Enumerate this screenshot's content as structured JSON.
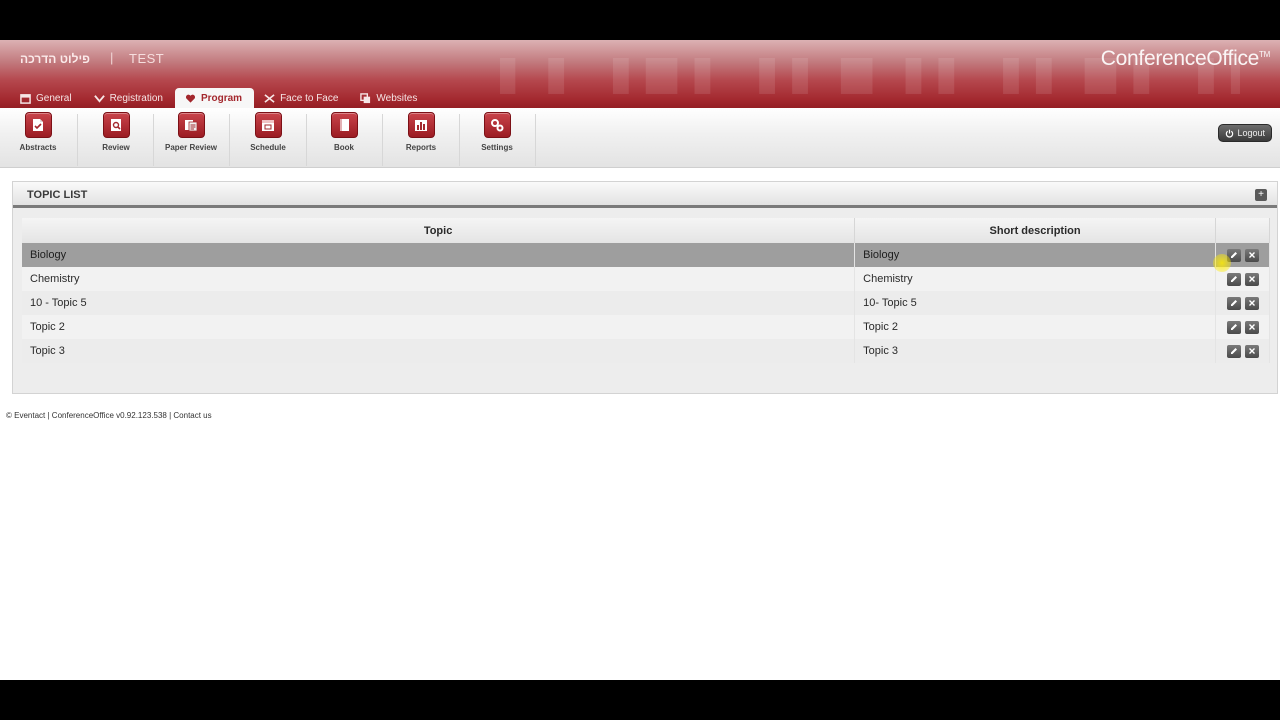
{
  "header": {
    "event_name": "פילוט הדרכה",
    "separator": "|",
    "event_code": "TEST",
    "brand": "ConferenceOffice",
    "brand_tm": "TM"
  },
  "tabs": [
    {
      "label": "General",
      "icon": "calendar-icon",
      "active": false
    },
    {
      "label": "Registration",
      "icon": "check-icon",
      "active": false
    },
    {
      "label": "Program",
      "icon": "heart-icon",
      "active": true
    },
    {
      "label": "Face to Face",
      "icon": "cross-arrows-icon",
      "active": false
    },
    {
      "label": "Websites",
      "icon": "globe-icon",
      "active": false
    }
  ],
  "toolbar": {
    "items": [
      {
        "label": "Abstracts",
        "icon": "abstracts-icon"
      },
      {
        "label": "Review",
        "icon": "review-icon"
      },
      {
        "label": "Paper Review",
        "icon": "paper-review-icon"
      },
      {
        "label": "Schedule",
        "icon": "schedule-icon"
      },
      {
        "label": "Book",
        "icon": "book-icon"
      },
      {
        "label": "Reports",
        "icon": "reports-icon"
      },
      {
        "label": "Settings",
        "icon": "settings-icon"
      }
    ],
    "logout_label": "Logout"
  },
  "panel": {
    "title": "TOPIC LIST",
    "toggle_symbol": "+"
  },
  "table": {
    "headers": [
      "Topic",
      "Short description"
    ],
    "rows": [
      {
        "topic": "Biology",
        "description": "Biology",
        "selected": true
      },
      {
        "topic": "Chemistry",
        "description": "Chemistry",
        "selected": false
      },
      {
        "topic": "10 - Topic 5",
        "description": "10- Topic 5",
        "selected": false
      },
      {
        "topic": "Topic 2",
        "description": "Topic 2",
        "selected": false
      },
      {
        "topic": "Topic 3",
        "description": "Topic 3",
        "selected": false
      }
    ]
  },
  "footer": {
    "copyright": "© Eventact",
    "separator1": "|",
    "version": "ConferenceOffice v0.92.123.538",
    "separator2": "|",
    "contact": "Contact us"
  },
  "colors": {
    "brand_red": "#a3282e",
    "selected_row": "#9e9e9e",
    "cursor_highlight": "#ffec00"
  }
}
